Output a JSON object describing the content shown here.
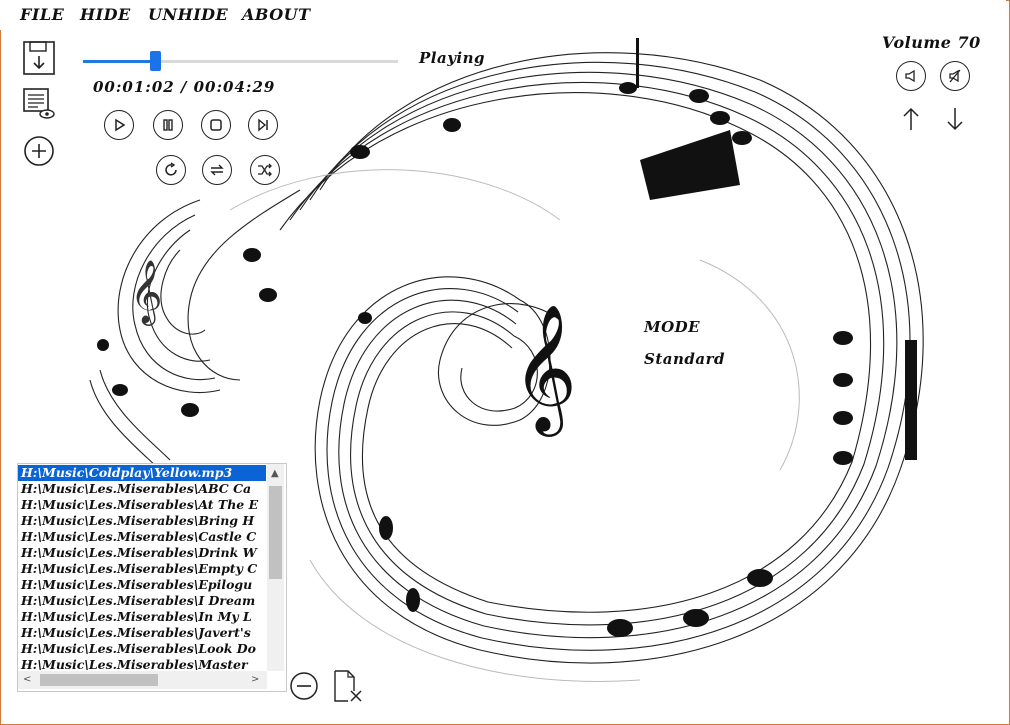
{
  "menu": {
    "file": "FILE",
    "hide": "HIDE",
    "unhide": "UNHIDE",
    "about": "ABOUT"
  },
  "player": {
    "time": "00:01:02 / 00:04:29",
    "progress_percent": 23,
    "status": "Playing",
    "volume_label": "Volume 70",
    "mode_title": "MODE",
    "mode_value": "Standard"
  },
  "icons": {
    "save": "save-download-icon",
    "view_list": "list-view-icon",
    "add": "add-circle-icon",
    "play": "play-icon",
    "pause": "pause-icon",
    "stop": "stop-icon",
    "next": "next-track-icon",
    "repeat": "repeat-icon",
    "loop": "loop-icon",
    "shuffle": "shuffle-icon",
    "volume_down": "volume-down-icon",
    "mute": "mute-icon",
    "up": "arrow-up-icon",
    "down": "arrow-down-icon",
    "remove": "remove-circle-icon",
    "clear": "clear-list-icon"
  },
  "playlist": {
    "items": [
      "H:\\Music\\Coldplay\\Yellow.mp3",
      "H:\\Music\\Les.Miserables\\ABC Ca",
      "H:\\Music\\Les.Miserables\\At The E",
      "H:\\Music\\Les.Miserables\\Bring H",
      "H:\\Music\\Les.Miserables\\Castle C",
      "H:\\Music\\Les.Miserables\\Drink W",
      "H:\\Music\\Les.Miserables\\Empty C",
      "H:\\Music\\Les.Miserables\\Epilogu",
      "H:\\Music\\Les.Miserables\\I Dream",
      "H:\\Music\\Les.Miserables\\In My L",
      "H:\\Music\\Les.Miserables\\Javert's",
      "H:\\Music\\Les.Miserables\\Look Do",
      "H:\\Music\\Les.Miserables\\Master"
    ],
    "selected_index": 0
  },
  "colors": {
    "accent": "#1a73e8",
    "selection": "#0a64d6",
    "window_border": "#d07a3a"
  }
}
